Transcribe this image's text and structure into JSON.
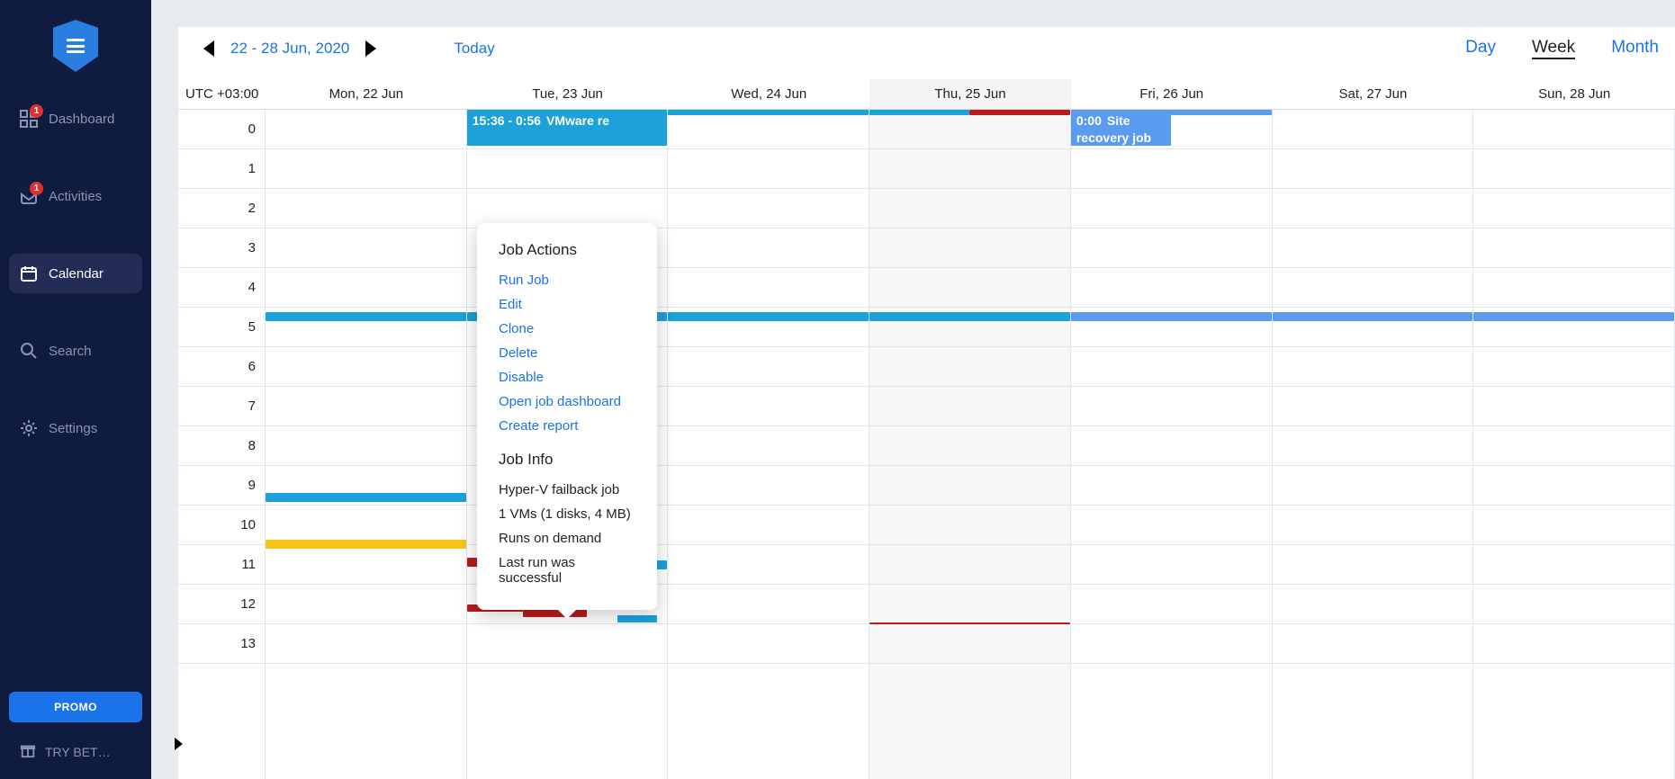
{
  "sidebar": {
    "items": [
      {
        "label": "Dashboard",
        "badge": "1"
      },
      {
        "label": "Activities",
        "badge": "1"
      },
      {
        "label": "Calendar"
      },
      {
        "label": "Search"
      },
      {
        "label": "Settings"
      }
    ],
    "promo_label": "PROMO",
    "try_beta_label": "TRY BET…"
  },
  "toolbar": {
    "date_range": "22 - 28 Jun, 2020",
    "today_label": "Today",
    "views": {
      "day": "Day",
      "week": "Week",
      "month": "Month"
    }
  },
  "calendar": {
    "tz_label": "UTC +03:00",
    "days": [
      "Mon, 22 Jun",
      "Tue, 23 Jun",
      "Wed, 24 Jun",
      "Thu, 25 Jun",
      "Fri, 26 Jun",
      "Sat, 27 Jun",
      "Sun, 28 Jun"
    ],
    "today_index": 3,
    "hours": [
      "0",
      "1",
      "2",
      "3",
      "4",
      "5",
      "6",
      "7",
      "8",
      "9",
      "10",
      "11",
      "12",
      "13"
    ],
    "event_vmware": {
      "time": "15:36 - 0:56",
      "title": "VMware re"
    },
    "event_site": {
      "time": "0:00",
      "title": "Site recovery job"
    }
  },
  "popover": {
    "actions_heading": "Job Actions",
    "actions": {
      "run": "Run Job",
      "edit": "Edit",
      "clone": "Clone",
      "delete": "Delete",
      "disable": "Disable",
      "open_dash": "Open job dashboard",
      "report": "Create report"
    },
    "info_heading": "Job Info",
    "info": {
      "name": "Hyper-V failback job",
      "vms": "1 VMs (1 disks, 4 MB)",
      "schedule": "Runs on demand",
      "last": "Last run was successful"
    }
  }
}
